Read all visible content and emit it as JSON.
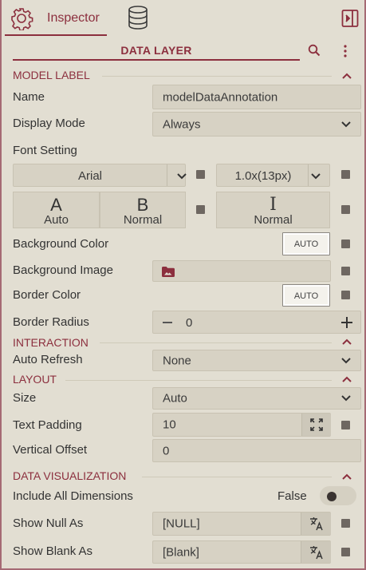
{
  "tabs": {
    "inspector_label": "Inspector",
    "icons": [
      "gear-icon",
      "database-icon",
      "panel-collapse-icon"
    ]
  },
  "panel": {
    "title": "DATA LAYER",
    "accent": "#8c2f3e",
    "background": "#e2ded2"
  },
  "model_label": {
    "header": "MODEL LABEL",
    "name_label": "Name",
    "name_value": "modelDataAnnotation",
    "display_mode_label": "Display Mode",
    "display_mode_value": "Always",
    "font_setting_label": "Font Setting",
    "font_family": "Arial",
    "font_size": "1.0x(13px)",
    "font_style_glyph": "A",
    "font_style_value": "Auto",
    "font_weight_glyph": "B",
    "font_weight_value": "Normal",
    "font_italic_glyph": "I",
    "font_italic_value": "Normal",
    "bg_color_label": "Background Color",
    "bg_color_value": "AUTO",
    "bg_image_label": "Background Image",
    "border_color_label": "Border Color",
    "border_color_value": "AUTO",
    "border_radius_label": "Border Radius",
    "border_radius_value": "0"
  },
  "interaction": {
    "header": "INTERACTION",
    "auto_refresh_label": "Auto Refresh",
    "auto_refresh_value": "None"
  },
  "layout": {
    "header": "LAYOUT",
    "size_label": "Size",
    "size_value": "Auto",
    "text_padding_label": "Text Padding",
    "text_padding_value": "10",
    "vertical_offset_label": "Vertical Offset",
    "vertical_offset_value": "0"
  },
  "data_visualization": {
    "header": "DATA VISUALIZATION",
    "include_all_label": "Include All Dimensions",
    "include_all_value": "False",
    "show_null_label": "Show Null As",
    "show_null_value": "[NULL]",
    "show_blank_label": "Show Blank As",
    "show_blank_value": "[Blank]"
  }
}
